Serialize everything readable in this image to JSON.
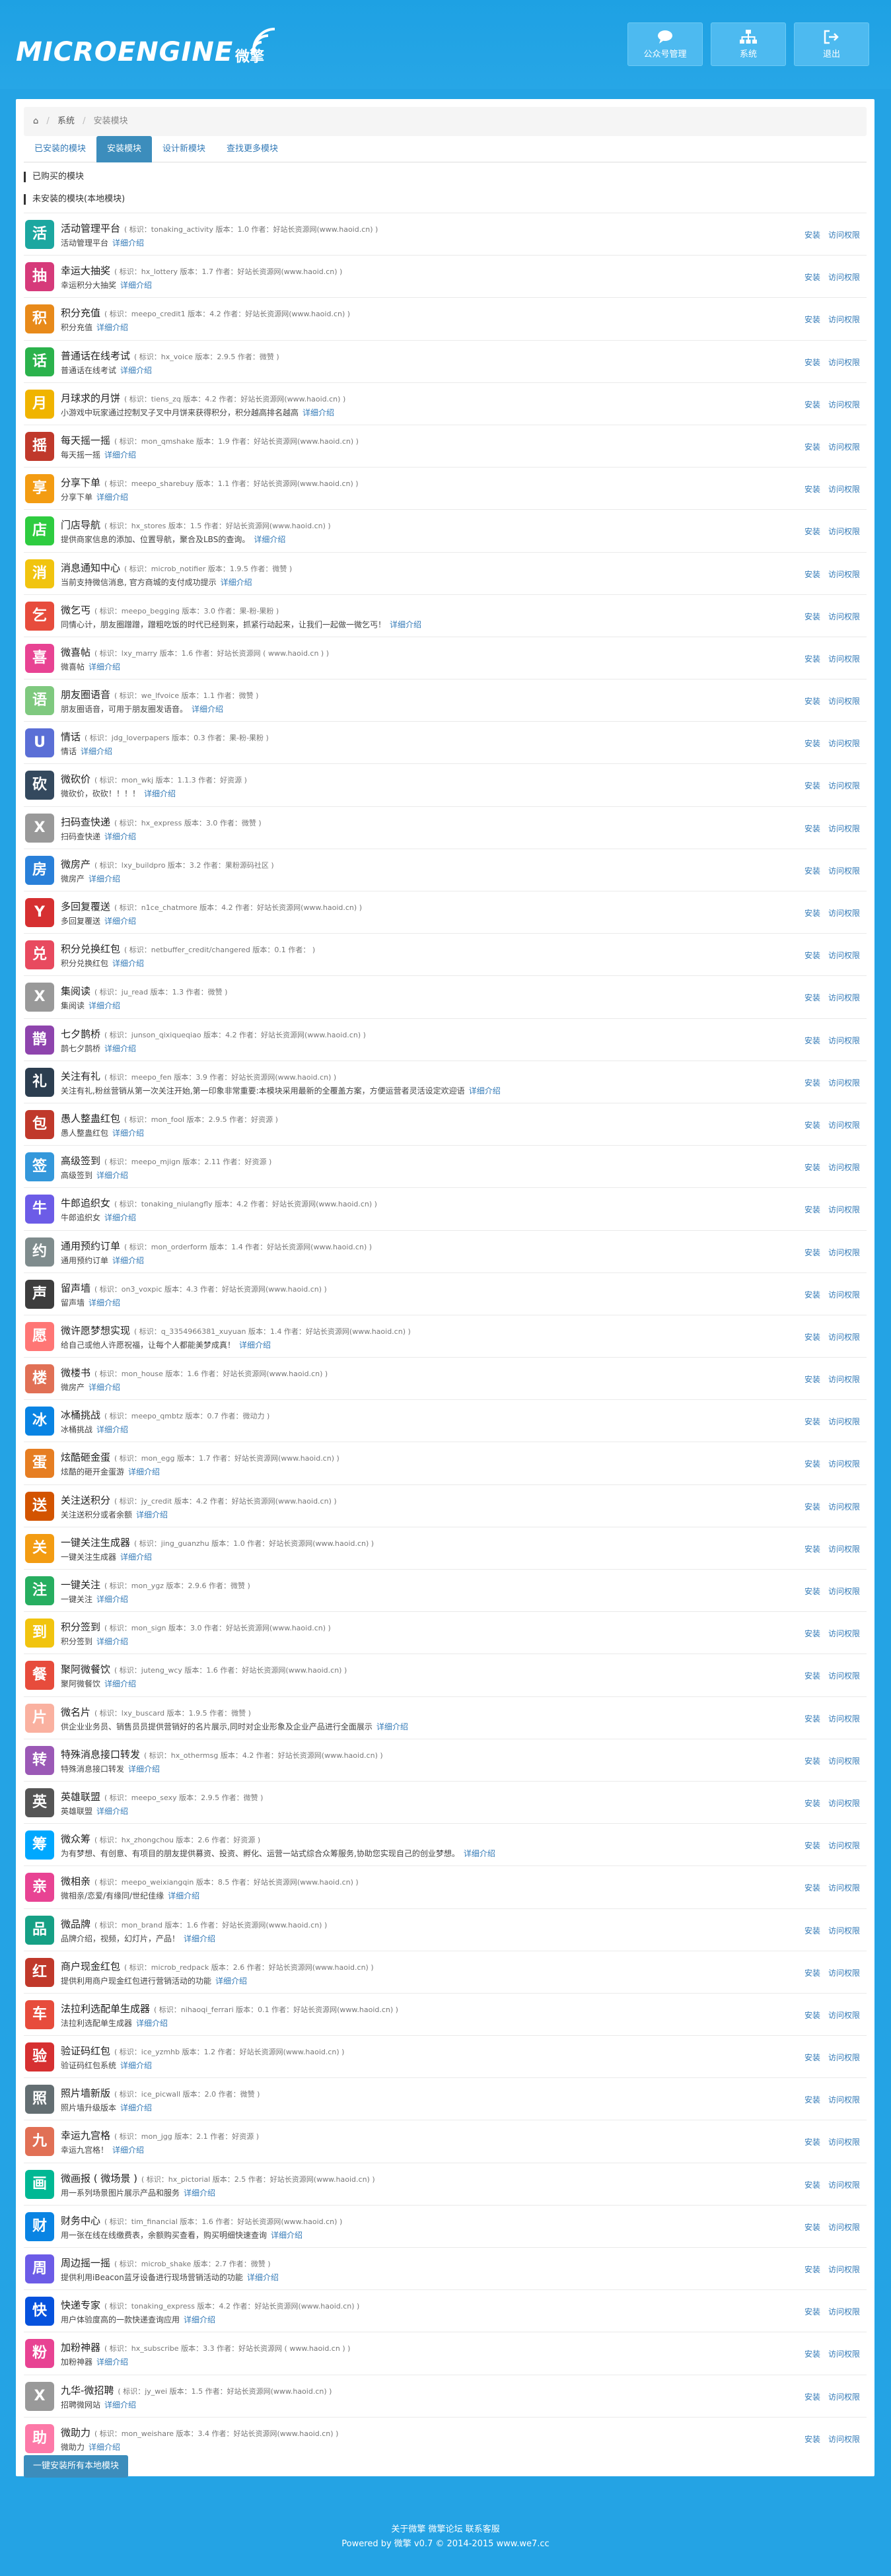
{
  "header": {
    "logo_text": "MICROENGINE",
    "logo_cn": "微擎",
    "buttons": [
      {
        "label": "公众号管理",
        "icon": "chat-icon"
      },
      {
        "label": "系统",
        "icon": "sitemap-icon"
      },
      {
        "label": "退出",
        "icon": "logout-icon"
      }
    ]
  },
  "breadcrumb": {
    "items": [
      "系统",
      "安装模块"
    ],
    "home_icon": "home-icon"
  },
  "tabs": [
    {
      "label": "已安装的模块",
      "active": false
    },
    {
      "label": "安装模块",
      "active": true
    },
    {
      "label": "设计新模块",
      "active": false
    },
    {
      "label": "查找更多模块",
      "active": false
    }
  ],
  "sections": {
    "purchased": "已购买的模块",
    "uninstalled": "未安装的模块(本地模块)"
  },
  "labels": {
    "detail": "详细介绍",
    "install": "安装",
    "visit_perm": "访问权限",
    "identifier": "标识",
    "version": "版本",
    "author": "作者"
  },
  "modules": [
    {
      "title": "活动管理平台",
      "meta": "( 标识：tonaking_activity  版本：1.0  作者：好站长资源网(www.haoid.cn) )",
      "desc": "活动管理平台",
      "color": "#1ca7a0",
      "glyph": "活"
    },
    {
      "title": "幸运大抽奖",
      "meta": "( 标识：hx_lottery  版本：1.7  作者：好站长资源网(www.haoid.cn) )",
      "desc": "幸运积分大抽奖",
      "color": "#d63a7a",
      "glyph": "抽"
    },
    {
      "title": "积分充值",
      "meta": "( 标识：meepo_credit1  版本：4.2  作者：好站长资源网(www.haoid.cn) )",
      "desc": "积分充值",
      "color": "#e88a1a",
      "glyph": "积"
    },
    {
      "title": "普通话在线考试",
      "meta": "( 标识：hx_voice  版本：2.9.5  作者：微赞 )",
      "desc": "普通话在线考试",
      "color": "#2bb24c",
      "glyph": "话"
    },
    {
      "title": "月球求的月饼",
      "meta": "( 标识：tiens_zq  版本：4.2  作者：好站长资源网(www.haoid.cn) )",
      "desc": "小游戏中玩家通过控制叉子叉中月饼来获得积分，积分越高排名越高",
      "color": "#f0b400",
      "glyph": "月"
    },
    {
      "title": "每天摇一摇",
      "meta": "( 标识：mon_qmshake  版本：1.9  作者：好站长资源网(www.haoid.cn) )",
      "desc": "每天摇一摇",
      "color": "#c0392b",
      "glyph": "摇"
    },
    {
      "title": "分享下单",
      "meta": "( 标识：meepo_sharebuy  版本：1.1  作者：好站长资源网(www.haoid.cn) )",
      "desc": "分享下单",
      "color": "#f39c12",
      "glyph": "享"
    },
    {
      "title": "门店导航",
      "meta": "( 标识：hx_stores  版本：1.5  作者：好站长资源网(www.haoid.cn) )",
      "desc": "提供商家信息的添加、位置导航，聚合及LBS的查询。",
      "color": "#2ecc40",
      "glyph": "店"
    },
    {
      "title": "消息通知中心",
      "meta": "( 标识：microb_notifier  版本：1.9.5  作者：微赞 )",
      "desc": "当前支持微信消息, 官方商城的支付成功提示",
      "color": "#f1c40f",
      "glyph": "消"
    },
    {
      "title": "微乞丐",
      "meta": "( 标识：meepo_begging  版本：3.0  作者：果-粉-果粉 )",
      "desc": "同情心计，朋友圈蹭蹭，蹭粗吃饭的时代已经到来，抓紧行动起来，让我们一起做一微乞丐！",
      "color": "#e74c3c",
      "glyph": "乞"
    },
    {
      "title": "微喜帖",
      "meta": "( 标识：lxy_marry  版本：1.6  作者：好站长资源网 ( www.haoid.cn ) )",
      "desc": "微喜帖",
      "color": "#e84393",
      "glyph": "喜"
    },
    {
      "title": "朋友圈语音",
      "meta": "( 标识：we_lfvoice  版本：1.1  作者：微赞 )",
      "desc": "朋友圈语音，可用于朋友圈发语音。",
      "color": "#7fc97f",
      "glyph": "语"
    },
    {
      "title": "情话",
      "meta": "( 标识：jdg_loverpapers  版本：0.3  作者：果-粉-果粉 )",
      "desc": "情话",
      "color": "#5b6fd6",
      "glyph": "U"
    },
    {
      "title": "微砍价",
      "meta": "( 标识：mon_wkj  版本：1.1.3  作者：好资源 )",
      "desc": "微砍价，砍砍！！！！",
      "color": "#34495e",
      "glyph": "砍"
    },
    {
      "title": "扫码查快递",
      "meta": "( 标识：hx_express  版本：3.0  作者：微赞 )",
      "desc": "扫码查快递",
      "color": "#999999",
      "glyph": "X"
    },
    {
      "title": "微房产",
      "meta": "( 标识：lxy_buildpro  版本：3.2  作者：果粉源码社区 )",
      "desc": "微房产",
      "color": "#2980d9",
      "glyph": "房"
    },
    {
      "title": "多回复覆送",
      "meta": "( 标识：n1ce_chatmore  版本：4.2  作者：好站长资源网(www.haoid.cn) )",
      "desc": "多回复覆送",
      "color": "#d63031",
      "glyph": "Y"
    },
    {
      "title": "积分兑换红包",
      "meta": "( 标识：netbuffer_credit/changered  版本：0.1  作者： )",
      "desc": "积分兑换红包",
      "color": "#e84a5f",
      "glyph": "兑"
    },
    {
      "title": "集阅读",
      "meta": "( 标识：ju_read  版本：1.3  作者：微赞 )",
      "desc": "集阅读",
      "color": "#999999",
      "glyph": "X"
    },
    {
      "title": "七夕鹊桥",
      "meta": "( 标识：junson_qixiqueqiao  版本：4.2  作者：好站长资源网(www.haoid.cn) )",
      "desc": "鹊七夕鹊桥",
      "color": "#8e44ad",
      "glyph": "鹊"
    },
    {
      "title": "关注有礼",
      "meta": "( 标识：meepo_fen  版本：3.9  作者：好站长资源网(www.haoid.cn) )",
      "desc": "关注有礼,粉丝营销从第一次关注开始,第一印象非常重要:本模块采用最新的全覆盖方案，方便运营者灵活设定欢迎语",
      "color": "#2c3e50",
      "glyph": "礼"
    },
    {
      "title": "愚人整蛊红包",
      "meta": "( 标识：mon_fool  版本：2.9.5  作者：好资源 )",
      "desc": "愚人整蛊红包",
      "color": "#c0392b",
      "glyph": "包"
    },
    {
      "title": "高级签到",
      "meta": "( 标识：meepo_mjign  版本：2.11  作者：好资源 )",
      "desc": "高级签到",
      "color": "#3498db",
      "glyph": "签"
    },
    {
      "title": "牛郎追织女",
      "meta": "( 标识：tonaking_niulangfly  版本：4.2  作者：好站长资源网(www.haoid.cn) )",
      "desc": "牛郎追织女",
      "color": "#6c5ce7",
      "glyph": "牛"
    },
    {
      "title": "通用预约订单",
      "meta": "( 标识：mon_orderform  版本：1.4  作者：好站长资源网(www.haoid.cn) )",
      "desc": "通用预约订单",
      "color": "#7f8c8d",
      "glyph": "约"
    },
    {
      "title": "留声墙",
      "meta": "( 标识：on3_voxpic  版本：4.3  作者：好站长资源网(www.haoid.cn) )",
      "desc": "留声墙",
      "color": "#3d3d3d",
      "glyph": "声"
    },
    {
      "title": "微许愿梦想实现",
      "meta": "( 标识：q_3354966381_xuyuan  版本：1.4  作者：好站长资源网(www.haoid.cn) )",
      "desc": "给自己或他人许愿祝福，让每个人都能美梦成真！",
      "color": "#ff7675",
      "glyph": "愿"
    },
    {
      "title": "微楼书",
      "meta": "( 标识：mon_house  版本：1.6  作者：好站长资源网(www.haoid.cn) )",
      "desc": "微房产",
      "color": "#e17055",
      "glyph": "楼"
    },
    {
      "title": "冰桶挑战",
      "meta": "( 标识：meepo_qmbtz  版本：0.7  作者：微动力 )",
      "desc": "冰桶挑战",
      "color": "#0984e3",
      "glyph": "冰"
    },
    {
      "title": "炫酷砸金蛋",
      "meta": "( 标识：mon_egg  版本：1.7  作者：好站长资源网(www.haoid.cn) )",
      "desc": "炫酷的砸开金蛋游",
      "color": "#e67e22",
      "glyph": "蛋"
    },
    {
      "title": "关注送积分",
      "meta": "( 标识：jy_credit  版本：4.2  作者：好站长资源网(www.haoid.cn) )",
      "desc": "关注送积分或者余额",
      "color": "#d35400",
      "glyph": "送"
    },
    {
      "title": "一键关注生成器",
      "meta": "( 标识：jing_guanzhu  版本：1.0  作者：好站长资源网(www.haoid.cn) )",
      "desc": "一键关注生成器",
      "color": "#f39c12",
      "glyph": "关"
    },
    {
      "title": "一键关注",
      "meta": "( 标识：mon_ygz  版本：2.9.6  作者：微赞 )",
      "desc": "一键关注",
      "color": "#27ae60",
      "glyph": "注"
    },
    {
      "title": "积分签到",
      "meta": "( 标识：mon_sign  版本：3.0  作者：好站长资源网(www.haoid.cn) )",
      "desc": "积分签到",
      "color": "#f1c40f",
      "glyph": "到"
    },
    {
      "title": "聚阿微餐饮",
      "meta": "( 标识：juteng_wcy  版本：1.6  作者：好站长资源网(www.haoid.cn) )",
      "desc": "聚阿微餐饮",
      "color": "#e74c3c",
      "glyph": "餐"
    },
    {
      "title": "微名片",
      "meta": "( 标识：lxy_buscard  版本：1.9.5  作者：微赞 )",
      "desc": "供企业业务员、销售员员提供营销好的名片展示,同时对企业形象及企业产品进行全面展示",
      "color": "#fab1a0",
      "glyph": "片"
    },
    {
      "title": "特殊消息接口转发",
      "meta": "( 标识：hx_othermsg  版本：4.2  作者：好站长资源网(www.haoid.cn) )",
      "desc": "特殊消息接口转发",
      "color": "#9b59b6",
      "glyph": "转"
    },
    {
      "title": "英雄联盟",
      "meta": "( 标识：meepo_sexy  版本：2.9.5  作者：微赞 )",
      "desc": "英雄联盟",
      "color": "#555555",
      "glyph": "英"
    },
    {
      "title": "微众筹",
      "meta": "( 标识：hx_zhongchou  版本：2.6  作者：好资源 )",
      "desc": "为有梦想、有创意、有项目的朋友提供募资、投资、孵化、运营一站式综合众筹服务,协助您实现自己的创业梦想。",
      "color": "#00a8ff",
      "glyph": "筹"
    },
    {
      "title": "微相亲",
      "meta": "( 标识：meepo_weixiangqin  版本：8.5  作者：好站长资源网(www.haoid.cn) )",
      "desc": "微相亲/恋爱/有缘同/世纪佳缘",
      "color": "#e84393",
      "glyph": "亲"
    },
    {
      "title": "微品牌",
      "meta": "( 标识：mon_brand  版本：1.6  作者：好站长资源网(www.haoid.cn) )",
      "desc": "品牌介绍，视频，幻灯片，产品！",
      "color": "#16a085",
      "glyph": "品"
    },
    {
      "title": "商户现金红包",
      "meta": "( 标识：microb_redpack  版本：2.6  作者：好站长资源网(www.haoid.cn) )",
      "desc": "提供利用商户现金红包进行营销活动的功能",
      "color": "#c0392b",
      "glyph": "红"
    },
    {
      "title": "法拉利选配单生成器",
      "meta": "( 标识：nihaoqi_ferrari  版本：0.1  作者：好站长资源网(www.haoid.cn) )",
      "desc": "法拉利选配单生成器",
      "color": "#e74c3c",
      "glyph": "车"
    },
    {
      "title": "验证码红包",
      "meta": "( 标识：ice_yzmhb  版本：1.2  作者：好站长资源网(www.haoid.cn) )",
      "desc": "验证码红包系统",
      "color": "#d63031",
      "glyph": "验"
    },
    {
      "title": "照片墙新版",
      "meta": "( 标识：ice_picwall  版本：2.0  作者：微赞 )",
      "desc": "照片墙升级版本",
      "color": "#636e72",
      "glyph": "照"
    },
    {
      "title": "幸运九宫格",
      "meta": "( 标识：mon_jgg  版本：2.1  作者：好资源 )",
      "desc": "幸运九宫格！",
      "color": "#e17055",
      "glyph": "九"
    },
    {
      "title": "微画报 ( 微场景 )",
      "meta": "( 标识：hx_pictorial  版本：2.5  作者：好站长资源网(www.haoid.cn) )",
      "desc": "用一系列场景图片展示产品和服务",
      "color": "#00b894",
      "glyph": "画"
    },
    {
      "title": "财务中心",
      "meta": "( 标识：tim_financial  版本：1.6  作者：好站长资源网(www.haoid.cn) )",
      "desc": "用一张在线在线缴费表，余额购买查看，购买明细快速查询",
      "color": "#0984e3",
      "glyph": "财"
    },
    {
      "title": "周边摇一摇",
      "meta": "( 标识：microb_shake  版本：2.7  作者：微赞 )",
      "desc": "提供利用iBeacon蓝牙设备进行现场营销活动的功能",
      "color": "#6c5ce7",
      "glyph": "周"
    },
    {
      "title": "快递专家",
      "meta": "( 标识：tonaking_express  版本：4.2  作者：好站长资源网(www.haoid.cn) )",
      "desc": "用户体验度高的一款快递查询应用",
      "color": "#0652dd",
      "glyph": "快"
    },
    {
      "title": "加粉神器",
      "meta": "( 标识：hx_subscribe  版本：3.3  作者：好站长资源网 ( www.haoid.cn ) )",
      "desc": "加粉神器",
      "color": "#e84393",
      "glyph": "粉"
    },
    {
      "title": "九华-微招聘",
      "meta": "( 标识：jy_wei  版本：1.5  作者：好站长资源网(www.haoid.cn) )",
      "desc": "招聘微网站",
      "color": "#999999",
      "glyph": "X"
    },
    {
      "title": "微助力",
      "meta": "( 标识：mon_weishare  版本：3.4  作者：好站长资源网(www.haoid.cn) )",
      "desc": "微助力",
      "color": "#fd79a8",
      "glyph": "助"
    }
  ],
  "bulk_button": "一键安装所有本地模块",
  "footer": {
    "links": "关于微擎  微擎论坛  联系客服",
    "copyright": "Powered by 微擎 v0.7 © 2014-2015 www.we7.cc"
  }
}
